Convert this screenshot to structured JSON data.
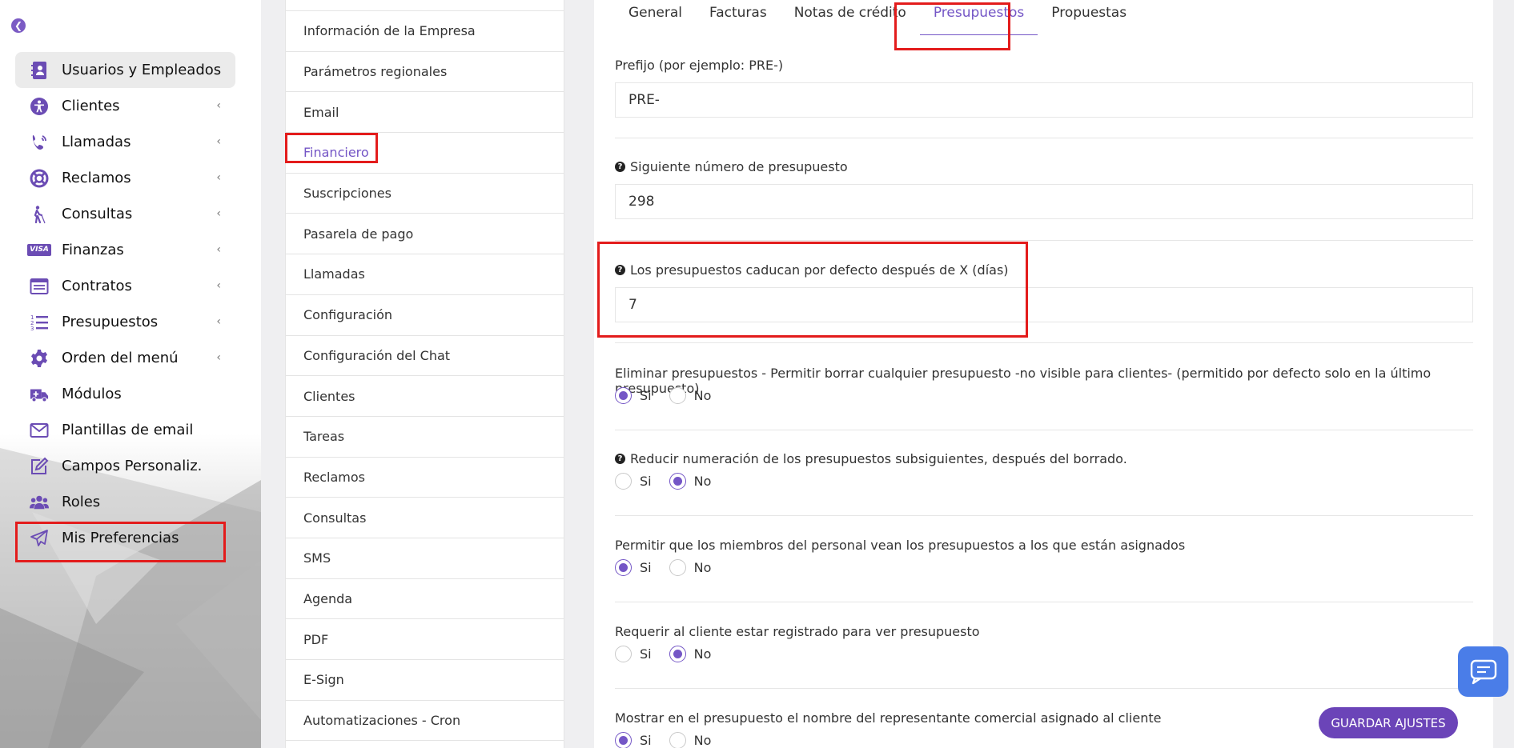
{
  "sidebar": {
    "items": [
      {
        "label": "Usuarios y Empleados",
        "icon": "contact-book-icon",
        "chevron": false,
        "active": true
      },
      {
        "label": "Clientes",
        "icon": "accessibility-icon",
        "chevron": true
      },
      {
        "label": "Llamadas",
        "icon": "phone-volume-icon",
        "chevron": true
      },
      {
        "label": "Reclamos",
        "icon": "lifebuoy-icon",
        "chevron": true
      },
      {
        "label": "Consultas",
        "icon": "blind-person-icon",
        "chevron": true
      },
      {
        "label": "Finanzas",
        "icon": "visa-card-icon",
        "chevron": true
      },
      {
        "label": "Contratos",
        "icon": "contract-list-icon",
        "chevron": true
      },
      {
        "label": "Presupuestos",
        "icon": "numbered-list-icon",
        "chevron": true
      },
      {
        "label": "Orden del menú",
        "icon": "gear-icon",
        "chevron": true
      },
      {
        "label": "Módulos",
        "icon": "ambulance-icon",
        "chevron": false
      },
      {
        "label": "Plantillas de email",
        "icon": "envelope-icon",
        "chevron": false
      },
      {
        "label": "Campos Personaliz.",
        "icon": "edit-icon",
        "chevron": false
      },
      {
        "label": "Roles",
        "icon": "users-icon",
        "chevron": false
      },
      {
        "label": "Mis Preferencias",
        "icon": "paper-plane-icon",
        "chevron": false
      }
    ],
    "visa_text": "VISA"
  },
  "subnav": {
    "items": [
      "Información de la Empresa",
      "Parámetros regionales",
      "Email",
      "Financiero",
      "Suscripciones",
      "Pasarela de pago",
      "Llamadas",
      "Configuración",
      "Configuración del Chat",
      "Clientes",
      "Tareas",
      "Reclamos",
      "Consultas",
      "SMS",
      "Agenda",
      "PDF",
      "E-Sign",
      "Automatizaciones - Cron"
    ],
    "active": "Financiero"
  },
  "tabs": [
    "General",
    "Facturas",
    "Notas de crédito",
    "Presupuestos",
    "Propuestas"
  ],
  "active_tab": "Presupuestos",
  "form": {
    "prefix": {
      "label": "Prefijo (por ejemplo: PRE-)",
      "value": "PRE-"
    },
    "next_number": {
      "label": "Siguiente número de presupuesto",
      "value": "298"
    },
    "expiry_days": {
      "label": "Los presupuestos caducan por defecto después de X (días)",
      "value": "7"
    },
    "radios": [
      {
        "label": "Eliminar presupuestos - Permitir borrar cualquier presupuesto -no visible para clientes- (permitido por defecto solo en la último presupuesto)",
        "help": false,
        "selected": "si"
      },
      {
        "label": "Reducir numeración de los presupuestos subsiguientes, después del borrado.",
        "help": true,
        "selected": "no"
      },
      {
        "label": "Permitir que los miembros del personal vean los presupuestos a los que están asignados",
        "help": false,
        "selected": "si"
      },
      {
        "label": "Requerir al cliente estar registrado para ver presupuesto",
        "help": false,
        "selected": "no"
      },
      {
        "label": "Mostrar en el presupuesto el nombre del representante comercial asignado al cliente",
        "help": false,
        "selected": "si"
      }
    ],
    "yes_label": "Si",
    "no_label": "No"
  },
  "save_button": "GUARDAR AJUSTES",
  "colors": {
    "accent": "#7456c6",
    "button": "#6b44b8",
    "chat": "#4a7de8",
    "highlight": "#e31c1c"
  }
}
